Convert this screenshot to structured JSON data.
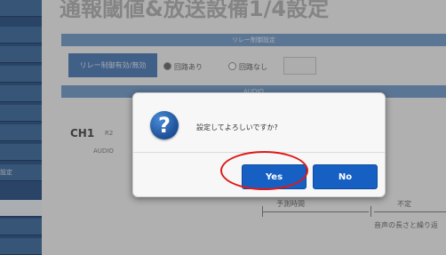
{
  "page": {
    "title": "通報閾値&放送設備1/4設定",
    "bars": [
      "リレー制御設定",
      "AUDIO"
    ],
    "relay_label": "リレー制御有効/無効",
    "relay_options": [
      "回路あり",
      "回路なし"
    ],
    "channel": "CH1",
    "channel_sub": "R2",
    "audio_label": "AUDIO",
    "timeline_label_1": "予測時間",
    "timeline_label_2": "不定",
    "timeline_label_3": "音声の長さと繰り返",
    "sidebar_items": [
      "",
      "",
      "",
      "",
      "",
      "",
      "",
      "",
      "設定",
      "",
      "",
      "",
      ""
    ]
  },
  "dialog": {
    "message": "設定してよろしいですか?",
    "yes_label": "Yes",
    "no_label": "No"
  },
  "colors": {
    "sidebar": "#3a5f8e",
    "button": "#1660c4",
    "highlight_circle": "#e01818"
  }
}
